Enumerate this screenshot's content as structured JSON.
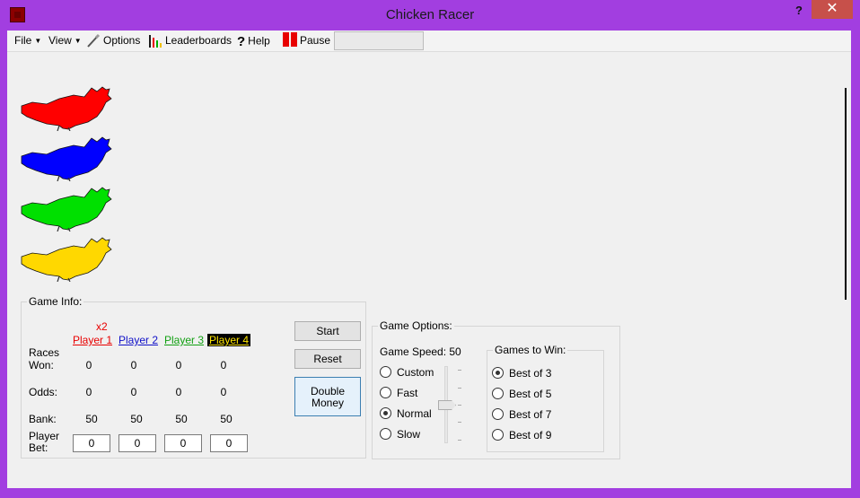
{
  "window": {
    "title": "Chicken Racer",
    "help_label": "?",
    "close_label": "✕"
  },
  "menu": {
    "file": "File",
    "view": "View",
    "options": "Options",
    "leaderboards": "Leaderboards",
    "help": "Help",
    "pause": "Pause",
    "textbox_value": ""
  },
  "chickens": [
    {
      "name": "red",
      "color": "#ff0000"
    },
    {
      "name": "blue",
      "color": "#0000ff"
    },
    {
      "name": "green",
      "color": "#00e000"
    },
    {
      "name": "yellow",
      "color": "#ffd800"
    }
  ],
  "game_info": {
    "legend": "Game Info:",
    "multiplier": "x2",
    "players": [
      {
        "label": "Player 1",
        "color": "#e80000",
        "races_won": "0",
        "odds": "0",
        "bank": "50",
        "bet": "0"
      },
      {
        "label": "Player 2",
        "color": "#1010c8",
        "races_won": "0",
        "odds": "0",
        "bank": "50",
        "bet": "0"
      },
      {
        "label": "Player 3",
        "color": "#12a012",
        "races_won": "0",
        "odds": "0",
        "bank": "50",
        "bet": "0"
      },
      {
        "label": "Player 4",
        "color": "#ffe600",
        "bg": "#000000",
        "races_won": "0",
        "odds": "0",
        "bank": "50",
        "bet": "0"
      }
    ],
    "row_labels": {
      "races_won_1": "Races",
      "races_won_2": "Won:",
      "odds": "Odds:",
      "bank": "Bank:",
      "bet_1": "Player",
      "bet_2": "Bet:"
    },
    "buttons": {
      "start": "Start",
      "reset": "Reset",
      "double_1": "Double",
      "double_2": "Money"
    }
  },
  "game_options": {
    "legend": "Game Options:",
    "speed_label": "Game Speed: 50",
    "speeds": [
      {
        "label": "Custom",
        "checked": false
      },
      {
        "label": "Fast",
        "checked": false
      },
      {
        "label": "Normal",
        "checked": true
      },
      {
        "label": "Slow",
        "checked": false
      }
    ],
    "slider_level": 50,
    "games_to_win": {
      "legend": "Games to Win:",
      "options": [
        {
          "label": "Best of 3",
          "checked": true
        },
        {
          "label": "Best of 5",
          "checked": false
        },
        {
          "label": "Best of 7",
          "checked": false
        },
        {
          "label": "Best of 9",
          "checked": false
        }
      ]
    }
  }
}
